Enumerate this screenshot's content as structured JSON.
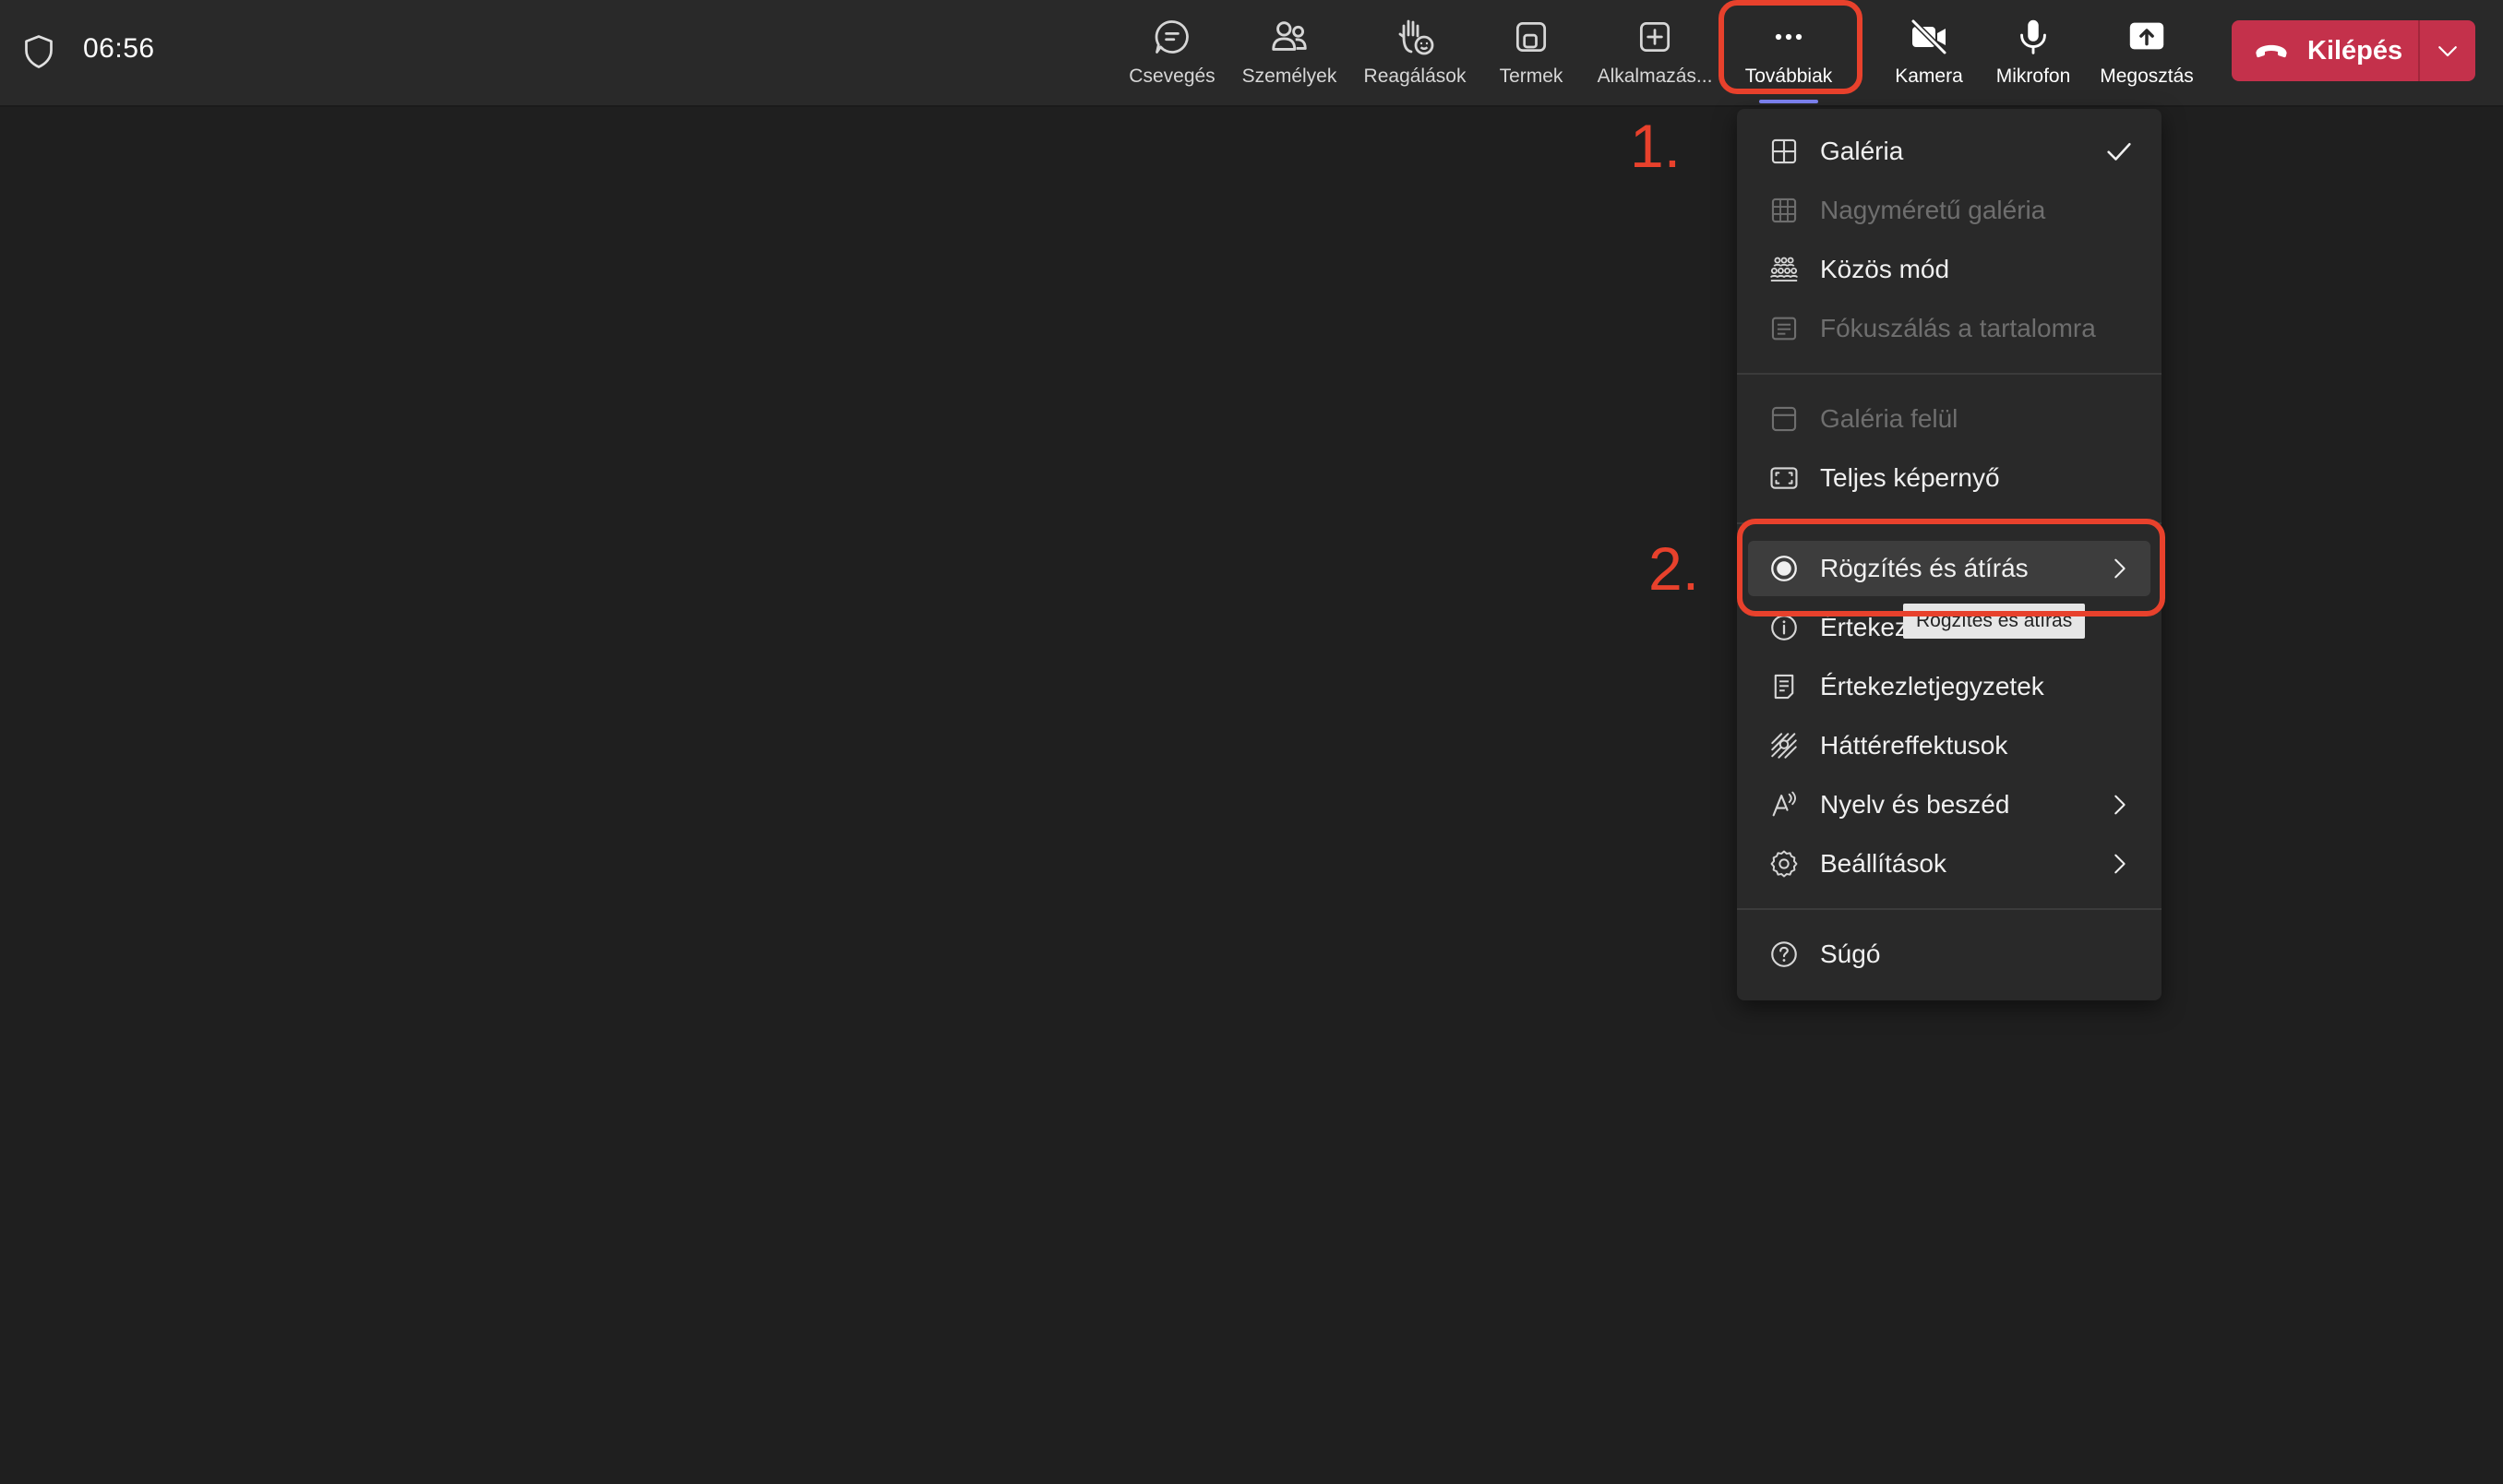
{
  "header": {
    "timer": "06:56",
    "shield_icon": "shield-icon"
  },
  "toolbar": {
    "items": [
      {
        "label": "Csevegés",
        "icon": "chat-icon"
      },
      {
        "label": "Személyek",
        "icon": "people-icon"
      },
      {
        "label": "Reagálások",
        "icon": "raise-hand-icon"
      },
      {
        "label": "Termek",
        "icon": "rooms-icon"
      },
      {
        "label": "Alkalmazás...",
        "icon": "add-app-icon"
      },
      {
        "label": "Továbbiak",
        "icon": "more-icon"
      },
      {
        "label": "Kamera",
        "icon": "camera-off-icon"
      },
      {
        "label": "Mikrofon",
        "icon": "microphone-icon"
      },
      {
        "label": "Megosztás",
        "icon": "share-icon"
      }
    ],
    "leave_label": "Kilépés"
  },
  "menu": {
    "items": [
      {
        "label": "Galéria",
        "enabled": true,
        "checked": true
      },
      {
        "label": "Nagyméretű galéria",
        "enabled": false
      },
      {
        "label": "Közös mód",
        "enabled": true
      },
      {
        "label": "Fókuszálás a tartalomra",
        "enabled": false
      },
      {
        "label": "Galéria felül",
        "enabled": false
      },
      {
        "label": "Teljes képernyő",
        "enabled": true
      },
      {
        "label": "Rögzítés és átírás",
        "enabled": true,
        "submenu": true
      },
      {
        "label": "Értekez",
        "enabled": true
      },
      {
        "label": "Értekezletjegyzetek",
        "enabled": true
      },
      {
        "label": "Háttéreffektusok",
        "enabled": true
      },
      {
        "label": "Nyelv és beszéd",
        "enabled": true,
        "submenu": true
      },
      {
        "label": "Beállítások",
        "enabled": true,
        "submenu": true
      },
      {
        "label": "Súgó",
        "enabled": true
      }
    ],
    "tooltip": "Rögzítés és átírás"
  },
  "annotations": {
    "step1": "1.",
    "step2": "2."
  },
  "colors": {
    "background": "#1f1f1f",
    "topbar": "#292929",
    "leave": "#c4314b",
    "annotation": "#e8412c",
    "accent": "#7f85f5"
  }
}
